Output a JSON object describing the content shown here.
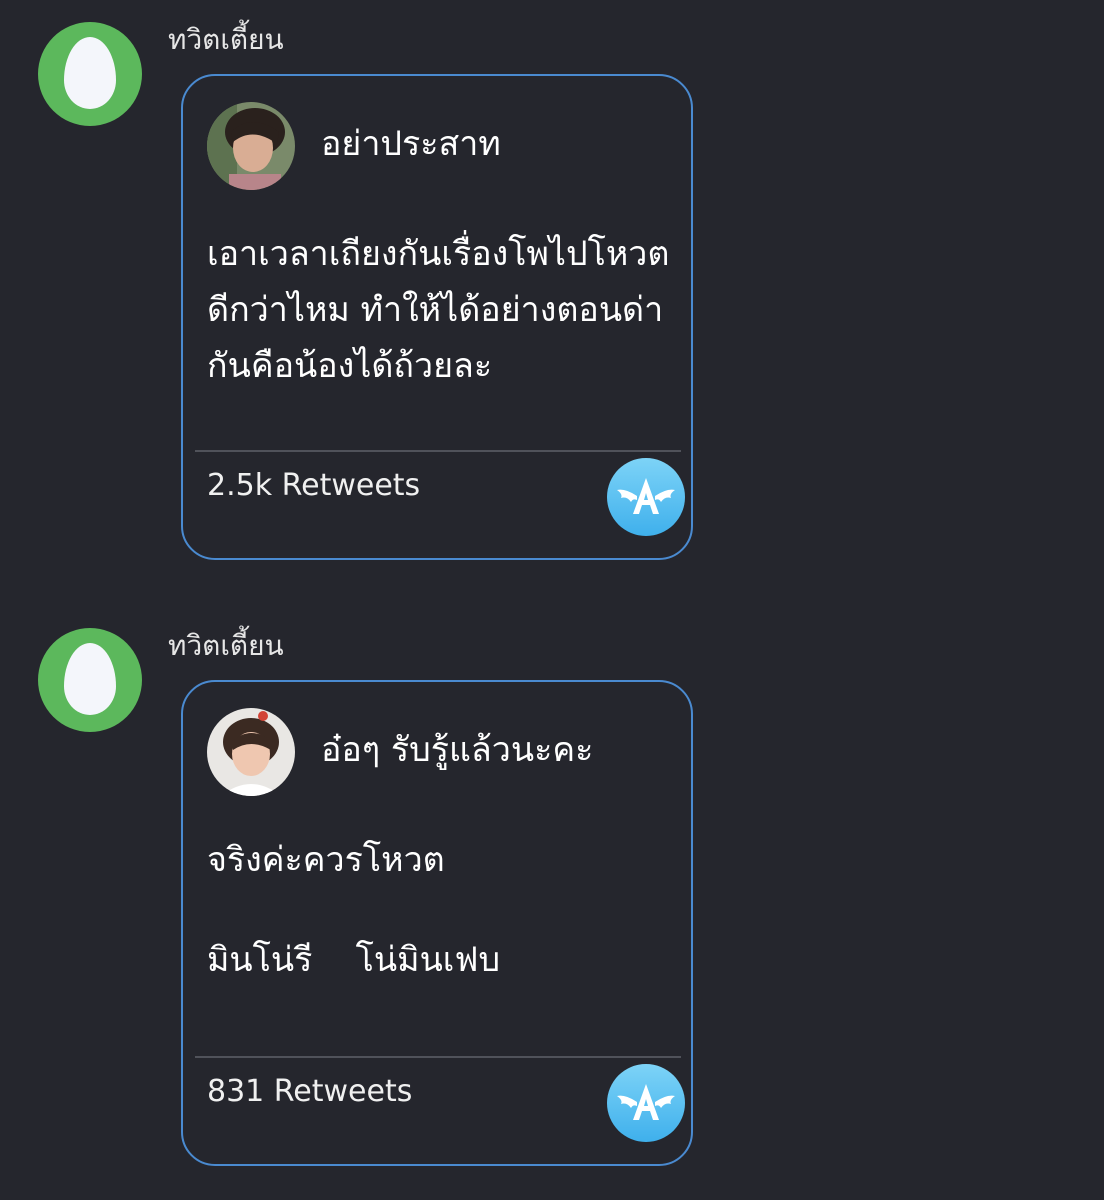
{
  "posts": [
    {
      "poster_name": "ทวิตเตี้ยน",
      "card": {
        "author": "อย่าประสาท",
        "body_lines": [
          "เอาเวลาเถียงกันเรื่องโพไปโหวต",
          "ดีกว่าไหม ทำให้ได้อย่างตอนด่า",
          "กันคือน้องได้ถ้วยละ"
        ],
        "retweets": "2.5k Retweets"
      }
    },
    {
      "poster_name": "ทวิตเตี้ยน",
      "card": {
        "author": "อ๋อๆ รับรู้แล้วนะคะ",
        "body_lines": [
          "จริงค่ะควรโหวต",
          "",
          "มินโน่รี    โน่มินเฟบ"
        ],
        "retweets": "831 Retweets"
      }
    }
  ],
  "colors": {
    "background": "#25262d",
    "egg_avatar": "#5cb85c",
    "card_border": "#4a8ad0",
    "badge": "#3fb0ec"
  },
  "icons": {
    "poster_avatar": "egg-avatar-icon",
    "app_badge": "winged-a-app-icon"
  }
}
